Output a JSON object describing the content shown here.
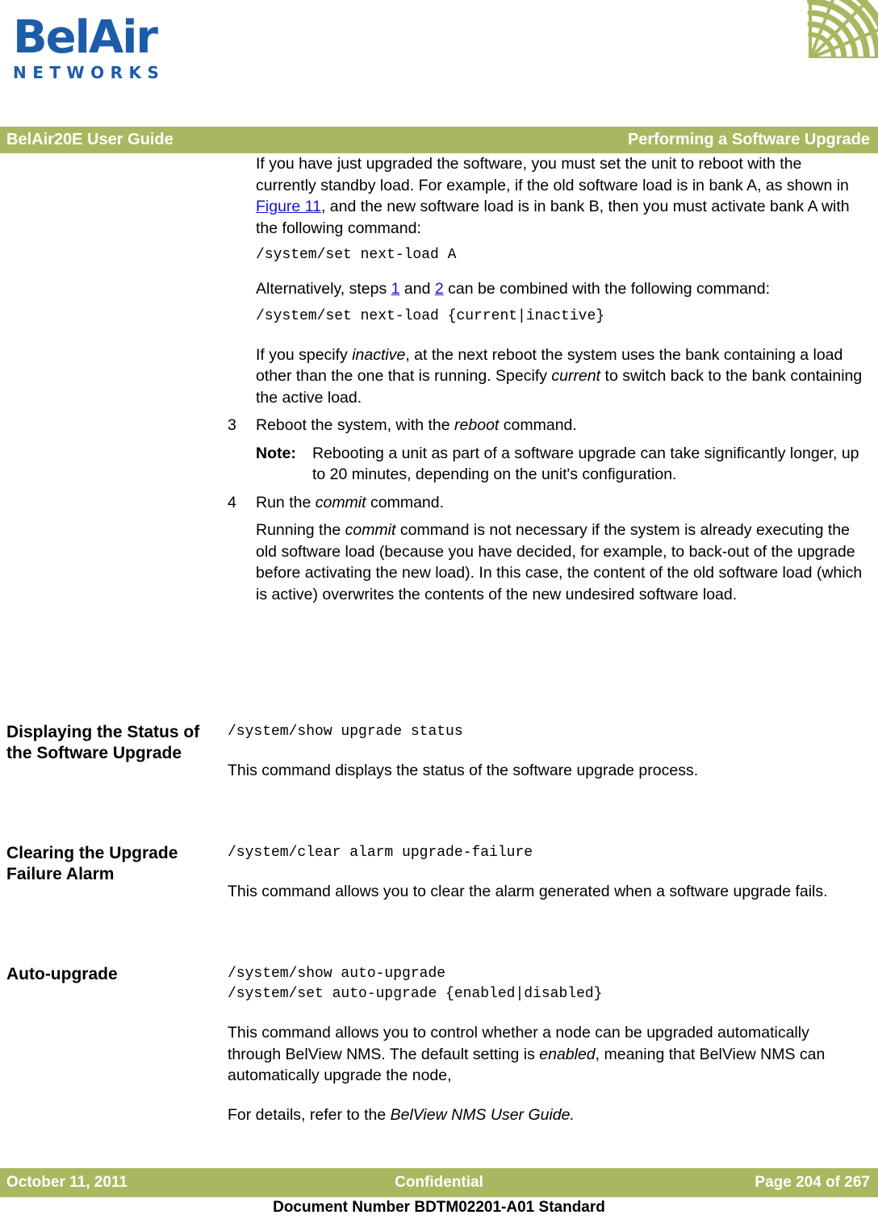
{
  "brand": {
    "logo_wordmark": "BelAir",
    "logo_sub": "NETWORKS",
    "logo_color": "#1C5CA8",
    "accent_color": "#A9B860",
    "link_color": "#1414D2",
    "corner_decoration": "radial-web-graphic"
  },
  "running_head": {
    "left": "BelAir20E User Guide",
    "right": "Performing a Software Upgrade"
  },
  "intro": {
    "para1_a": "If you have just upgraded the software, you must set the unit to reboot with the currently standby load. For example, if the old software load is in bank A, as shown in ",
    "para1_link": "Figure 11",
    "para1_b": ", and the new software load is in bank B, then you must activate bank A with the following command:",
    "cmd1": "/system/set next-load A",
    "para2_a": "Alternatively, steps ",
    "para2_link1": "1",
    "para2_mid": " and ",
    "para2_link2": "2",
    "para2_b": " can be combined with the following command:",
    "cmd2": "/system/set next-load {current|inactive}",
    "para3_a": "If you specify ",
    "para3_i1": "inactive",
    "para3_b": ", at the next reboot the system uses the bank containing a load other than the one that is running. Specify ",
    "para3_i2": "current",
    "para3_c": " to switch back to the bank containing the active load."
  },
  "steps": [
    {
      "number": "3",
      "text_a": "Reboot the system, with the ",
      "text_i": "reboot",
      "text_b": " command."
    },
    {
      "number": "4",
      "text_a": "Run the ",
      "text_i": "commit",
      "text_b": " command."
    }
  ],
  "note": {
    "label": "Note:",
    "text": "Rebooting a unit as part of a software upgrade can take significantly longer, up to 20 minutes, depending on the unit's configuration."
  },
  "step4_body": {
    "a": "Running the ",
    "i": "commit",
    "b": " command is not necessary if the system is already executing the old software load (because you have decided, for example, to back-out of the upgrade before activating the new load). In this case, the content of the old software load (which is active) overwrites the contents of the new undesired software load."
  },
  "sections": [
    {
      "heading": "Displaying the Status of the Software Upgrade",
      "command": "/system/show upgrade status",
      "body": "This command displays the status of the software upgrade process."
    },
    {
      "heading": "Clearing the Upgrade Failure Alarm",
      "command": "/system/clear alarm upgrade-failure",
      "body": "This command allows you to clear the alarm generated when a software upgrade fails."
    },
    {
      "heading": "Auto-upgrade",
      "command_line1": "/system/show auto-upgrade",
      "command_line2": "/system/set auto-upgrade {enabled|disabled}",
      "body_a": "This command allows you to control whether a node can be upgraded automatically through BelView NMS. The default setting is ",
      "body_i": "enabled",
      "body_b": ", meaning that BelView NMS can automatically upgrade the node,",
      "body2_a": "For details, refer to the ",
      "body2_i": "BelView NMS User Guide."
    }
  ],
  "footer": {
    "date": "October 11, 2011",
    "classification": "Confidential",
    "page": "Page 204 of 267",
    "doc_number": "Document Number BDTM02201-A01 Standard"
  }
}
